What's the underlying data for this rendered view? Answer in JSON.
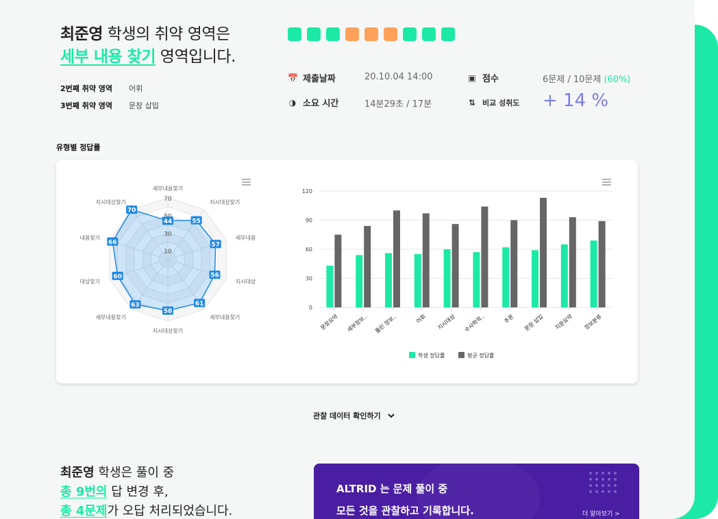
{
  "header": {
    "student_name": "최준영",
    "title_suffix": " 학생의 취약 영역은",
    "weak_area": "세부 내용 찾기",
    "title_end": " 영역입니다.",
    "second_weak_label": "2번째 취약 영역",
    "second_weak_value": "어휘",
    "third_weak_label": "3번째 취약 영역",
    "third_weak_value": "문장 삽입"
  },
  "answer_squares": [
    "correct",
    "correct",
    "correct",
    "wrong",
    "wrong",
    "wrong",
    "correct",
    "correct",
    "correct"
  ],
  "colors": {
    "correct": "#1de9a7",
    "wrong": "#ffa15a",
    "accent": "#1de9a7",
    "avg": "#666666",
    "radar": "#1e88e5",
    "improve": "#7a7ee6"
  },
  "meta": {
    "submit_label": "제출날짜",
    "submit_value": "20.10.04 14:00",
    "score_label": "점수",
    "score_value": "6문제 / 10문제",
    "score_pct": "(60%)",
    "time_label": "소요 시간",
    "time_value": "14분29초 / 17분",
    "compare_label": "비교 성취도",
    "compare_value": "+ 14 %"
  },
  "section_title": "유형별 정답률",
  "observe_button": "관찰 데이터 확인하기",
  "bottom": {
    "line1_name": "최준영",
    "line1_rest": " 학생은 풀이 중",
    "line2_hl": "총 9번의",
    "line2_rest": " 답 변경 후,",
    "line3_hl": "총 4문제",
    "line3_rest": "가 오답 처리되었습니다."
  },
  "promo": {
    "line1": "ALTRID 는 문제 풀이 중",
    "line2": "모든 것을 관찰하고 기록합니다.",
    "more": "더 알아보기 >"
  },
  "chart_data": [
    {
      "type": "radar",
      "categories": [
        "세부내용찾기",
        "지시대상찾기",
        "세부내용",
        "지시대상",
        "세부내용찾기",
        "지시대상찾기",
        "세부내용찾기",
        "대상찾기",
        "내용찾기",
        "지시대상찾기"
      ],
      "values": [
        44,
        55,
        57,
        56,
        61,
        58,
        63,
        60,
        66,
        70
      ],
      "ticks": [
        10,
        30,
        50,
        70
      ],
      "range": [
        0,
        70
      ]
    },
    {
      "type": "bar",
      "categories": [
        "문장요약",
        "세부정보..",
        "틀린 정보..",
        "어휘",
        "지시대상",
        "수사학적..",
        "추론",
        "문장 삽입",
        "지문요약",
        "정보분류"
      ],
      "series": [
        {
          "name": "학생 정답률",
          "values": [
            43,
            54,
            56,
            55,
            60,
            57,
            62,
            59,
            65,
            69
          ]
        },
        {
          "name": "평균 정답률",
          "values": [
            75,
            84,
            100,
            97,
            86,
            104,
            90,
            113,
            93,
            89
          ]
        }
      ],
      "yticks": [
        0,
        30,
        60,
        90,
        120
      ],
      "ylim": [
        0,
        120
      ],
      "legend": "bottom"
    }
  ]
}
